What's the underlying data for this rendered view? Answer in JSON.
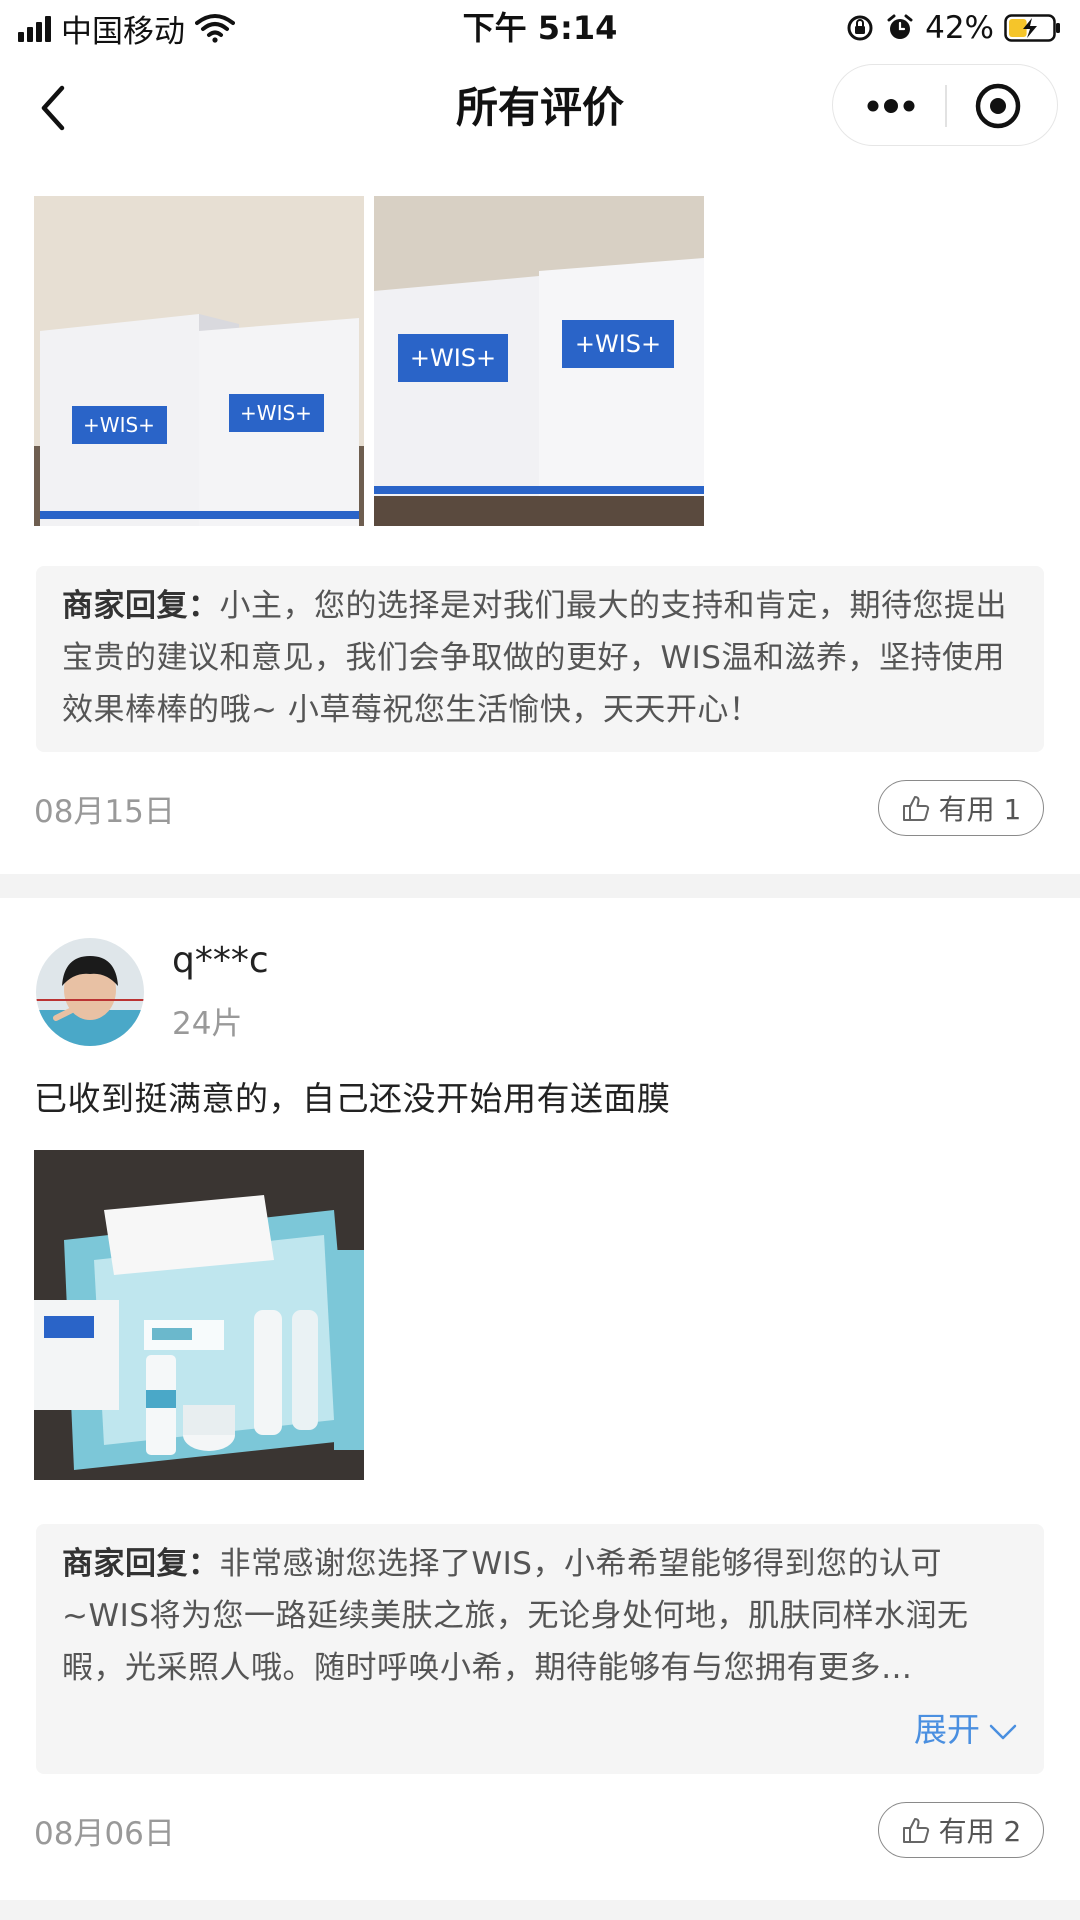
{
  "status_bar": {
    "carrier": "中国移动",
    "time": "下午 5:14",
    "battery": "42%",
    "battery_level": 0.42,
    "icons": [
      "signal-icon",
      "wifi-icon",
      "rotation-lock-icon",
      "alarm-icon",
      "battery-icon"
    ]
  },
  "nav": {
    "title": "所有评价",
    "icons": [
      "back-icon",
      "more-icon",
      "close-target-icon"
    ]
  },
  "reviews": [
    {
      "photos": [
        "WIS mask boxes photo 1",
        "WIS mask boxes photo 2"
      ],
      "reply_label": "商家回复：",
      "reply_text": "小主，您的选择是对我们最大的支持和肯定，期待您提出宝贵的建议和意见，我们会争取做的更好，WIS温和滋养，坚持使用效果棒棒的哦~ 小草莓祝您生活愉快，天天开心！",
      "date": "08月15日",
      "useful_label": "有用 1"
    },
    {
      "user": "q***c",
      "meta": "24片",
      "text": "已收到挺满意的，自己还没开始用有送面膜",
      "photos": [
        "WIS skincare gift set photo"
      ],
      "reply_label": "商家回复：",
      "reply_text": "非常感谢您选择了WIS，小希希望能够得到您的认可~WIS将为您一路延续美肤之旅，无论身处何地，肌肤同样水润无暇，光采照人哦。随时呼唤小希，期待能够有与您拥有更多…",
      "expand_label": "展开",
      "date": "08月06日",
      "useful_label": "有用 2"
    }
  ],
  "colors": {
    "link_blue": "#4a8fe0",
    "reply_bg": "#f5f5f5",
    "divider": "#f3f3f3",
    "wis_blue": "#2a64c8"
  }
}
